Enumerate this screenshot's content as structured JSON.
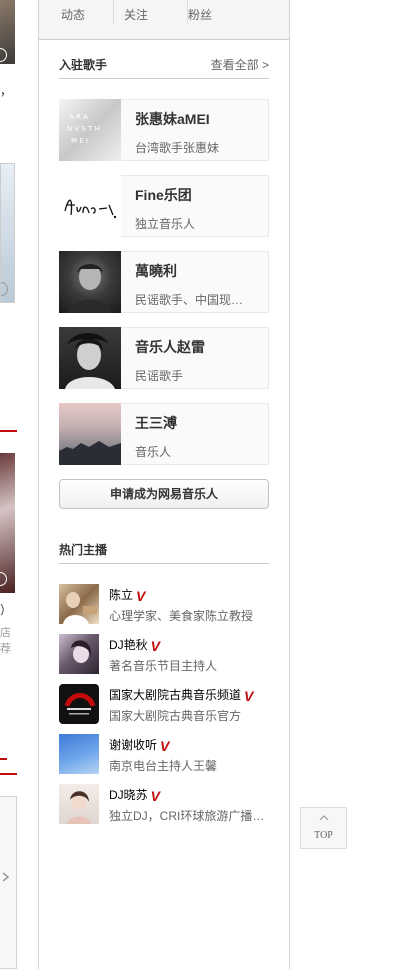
{
  "left_column": {
    "punctuation_1": "，",
    "paren": "）",
    "char_1": "店",
    "char_2": "荐"
  },
  "user_stats": [
    {
      "label": "动态"
    },
    {
      "label": "关注"
    },
    {
      "label": "粉丝"
    }
  ],
  "artists_section": {
    "title": "入驻歌手",
    "more": "查看全部 >",
    "items": [
      {
        "name": "张惠妹aMEI",
        "desc": "台湾歌手张惠妹"
      },
      {
        "name": "Fine乐团",
        "desc": "独立音乐人"
      },
      {
        "name": "萬曉利",
        "desc": "民谣歌手、中国现…"
      },
      {
        "name": "音乐人赵雷",
        "desc": "民谣歌手"
      },
      {
        "name": "王三溥",
        "desc": "音乐人"
      }
    ],
    "apply_label": "申请成为网易音乐人"
  },
  "dj_section": {
    "title": "热门主播",
    "items": [
      {
        "name": "陈立",
        "desc": "心理学家、美食家陈立教授"
      },
      {
        "name": "DJ艳秋",
        "desc": "著名音乐节目主持人"
      },
      {
        "name": "国家大剧院古典音乐频道",
        "desc": "国家大剧院古典音乐官方"
      },
      {
        "name": "谢谢收听",
        "desc": "南京电台主持人王馨"
      },
      {
        "name": "DJ晓苏",
        "desc": "独立DJ，CRI环球旅游广播…"
      }
    ],
    "verified_mark": "V"
  },
  "back_to_top": {
    "label": "TOP"
  },
  "colors": {
    "accent_red": "#c20c0c",
    "border": "#d3d3d3",
    "muted": "#666666"
  }
}
